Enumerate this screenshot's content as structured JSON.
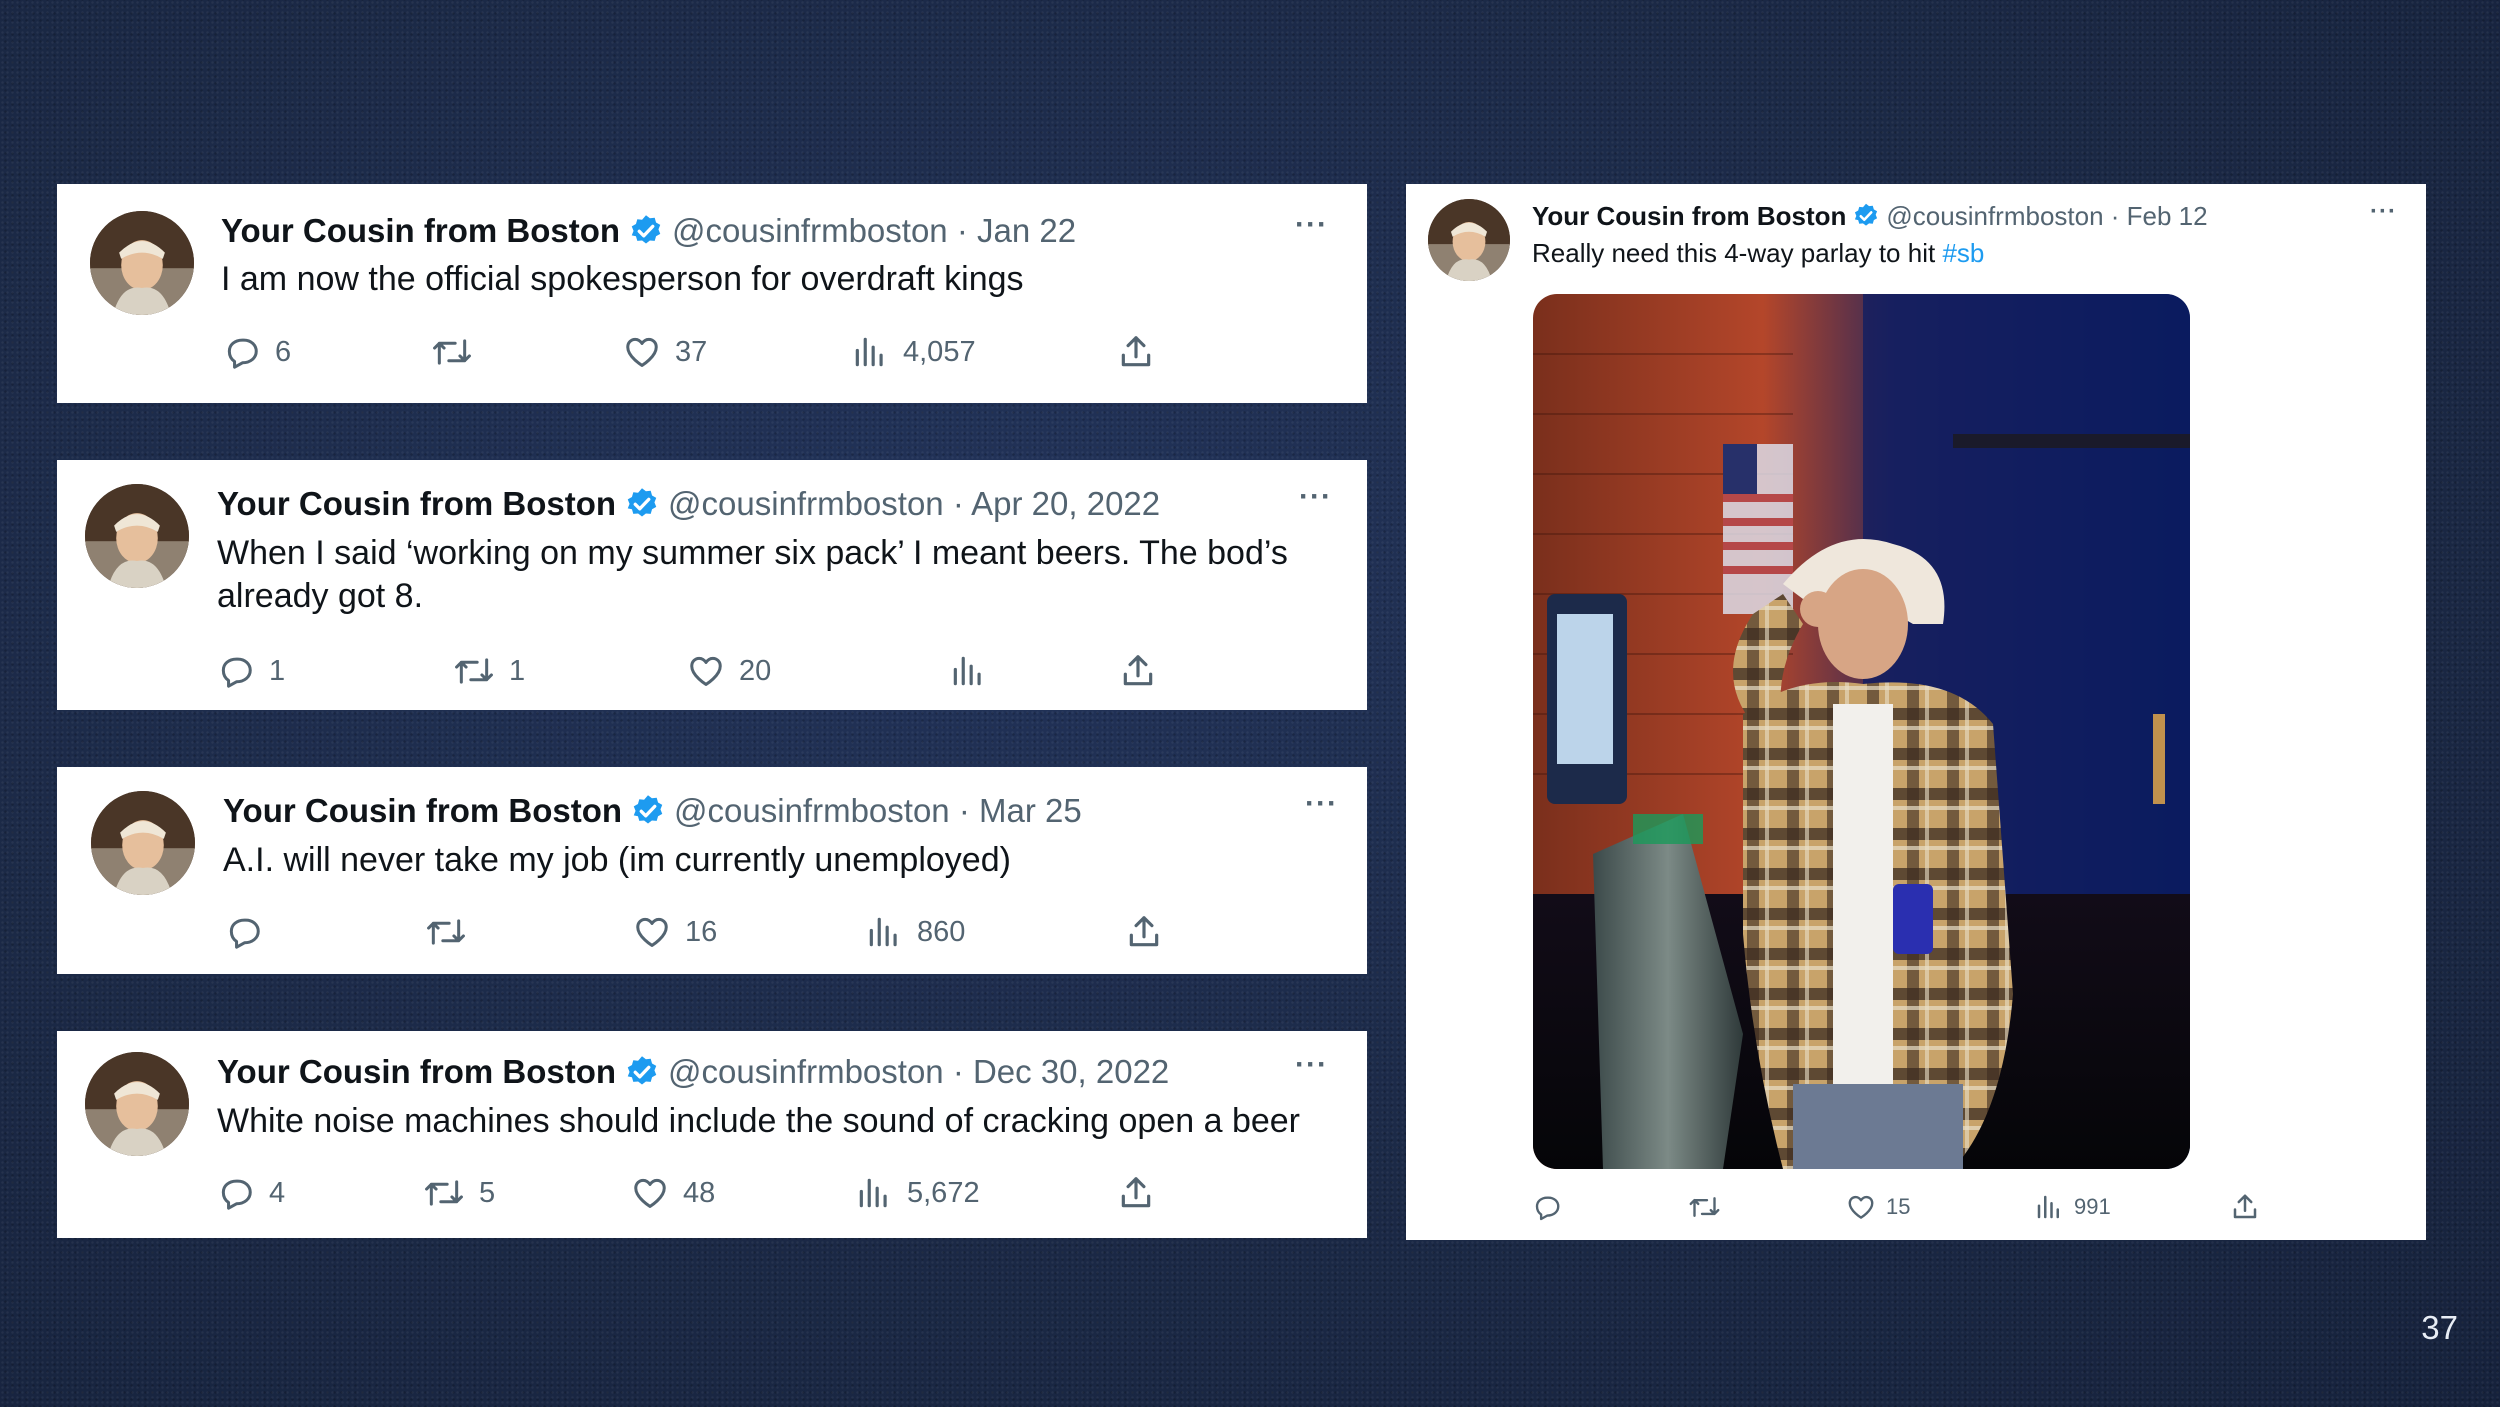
{
  "colors": {
    "background": "#1c2b4a",
    "card": "#ffffff",
    "name_text": "#0f1419",
    "meta_text": "#536471",
    "verified_badge": "#1d9bf0",
    "hashtag": "#1d9bf0"
  },
  "icons": {
    "verified": "verified-badge-icon",
    "more": "more-dots-icon",
    "reply": "reply-icon",
    "retweet": "retweet-icon",
    "like": "heart-icon",
    "views": "views-icon",
    "share": "share-icon"
  },
  "tweets": [
    {
      "name": "Your Cousin from Boston",
      "handle_date": "@cousinfrmboston · Jan 22",
      "text": "I am now the official spokesperson for overdraft kings",
      "more": "···",
      "replies": "6",
      "retweets": "",
      "likes": "37",
      "views": "4,057"
    },
    {
      "name": "Your Cousin from Boston",
      "handle_date": "@cousinfrmboston · Apr 20, 2022",
      "text_line1": "When I said ‘working on my summer six pack’ I meant beers. The bod’s",
      "text_line2": "already got 8.",
      "more": "···",
      "replies": "1",
      "retweets": "1",
      "likes": "20",
      "views": ""
    },
    {
      "name": "Your Cousin from Boston",
      "handle_date": "@cousinfrmboston · Mar 25",
      "text": "A.I. will never take my job (im currently unemployed)",
      "more": "···",
      "replies": "",
      "retweets": "",
      "likes": "16",
      "views": "860"
    },
    {
      "name": "Your Cousin from Boston",
      "handle_date": "@cousinfrmboston · Dec 30, 2022",
      "text": "White noise machines should include the sound of cracking open a beer",
      "more": "···",
      "replies": "4",
      "retweets": "5",
      "likes": "48",
      "views": "5,672"
    },
    {
      "name": "Your Cousin from Boston",
      "handle_date": "@cousinfrmboston · Feb 12",
      "text": "Really need this 4-way parlay to hit ",
      "hashtag": "#sb",
      "more": "···",
      "replies": "",
      "retweets": "",
      "likes": "15",
      "views": "991"
    }
  ],
  "page_number": "37"
}
